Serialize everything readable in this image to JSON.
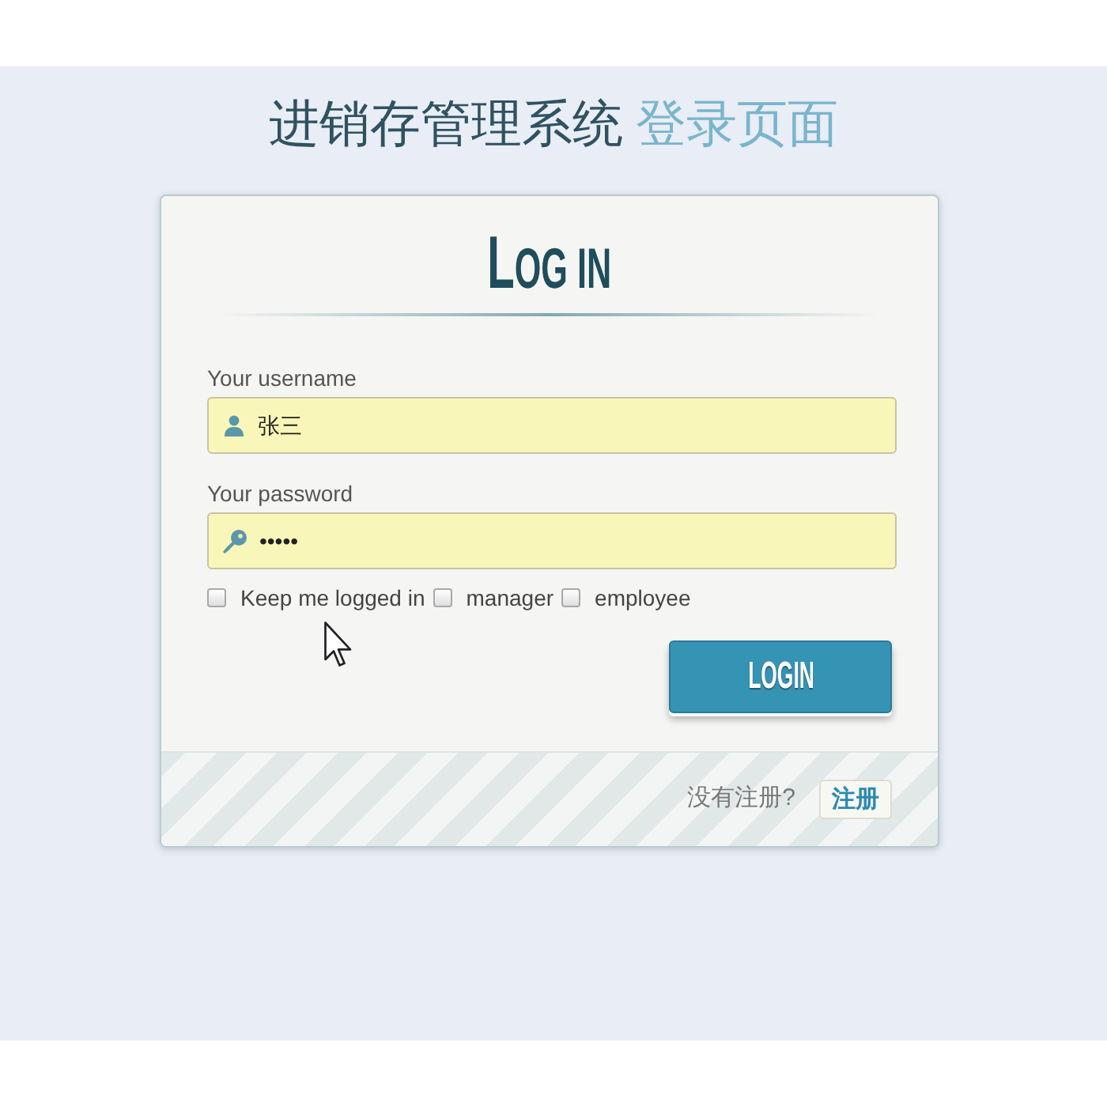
{
  "page_title": {
    "main": "进销存管理系统",
    "highlight": "登录页面"
  },
  "form": {
    "heading": "LOG IN",
    "fields": [
      {
        "kind": "text",
        "label": "Your username",
        "value": "张三"
      },
      {
        "kind": "password",
        "label": "Your password",
        "value": "•••••"
      }
    ],
    "options": [
      {
        "label": "Keep me logged in",
        "checked": false
      },
      {
        "label": "manager",
        "checked": false
      },
      {
        "label": "employee",
        "checked": false
      }
    ],
    "submit_button": "LOGIN"
  },
  "footer": {
    "prompt": "没有注册?",
    "register_button": "注册"
  }
}
